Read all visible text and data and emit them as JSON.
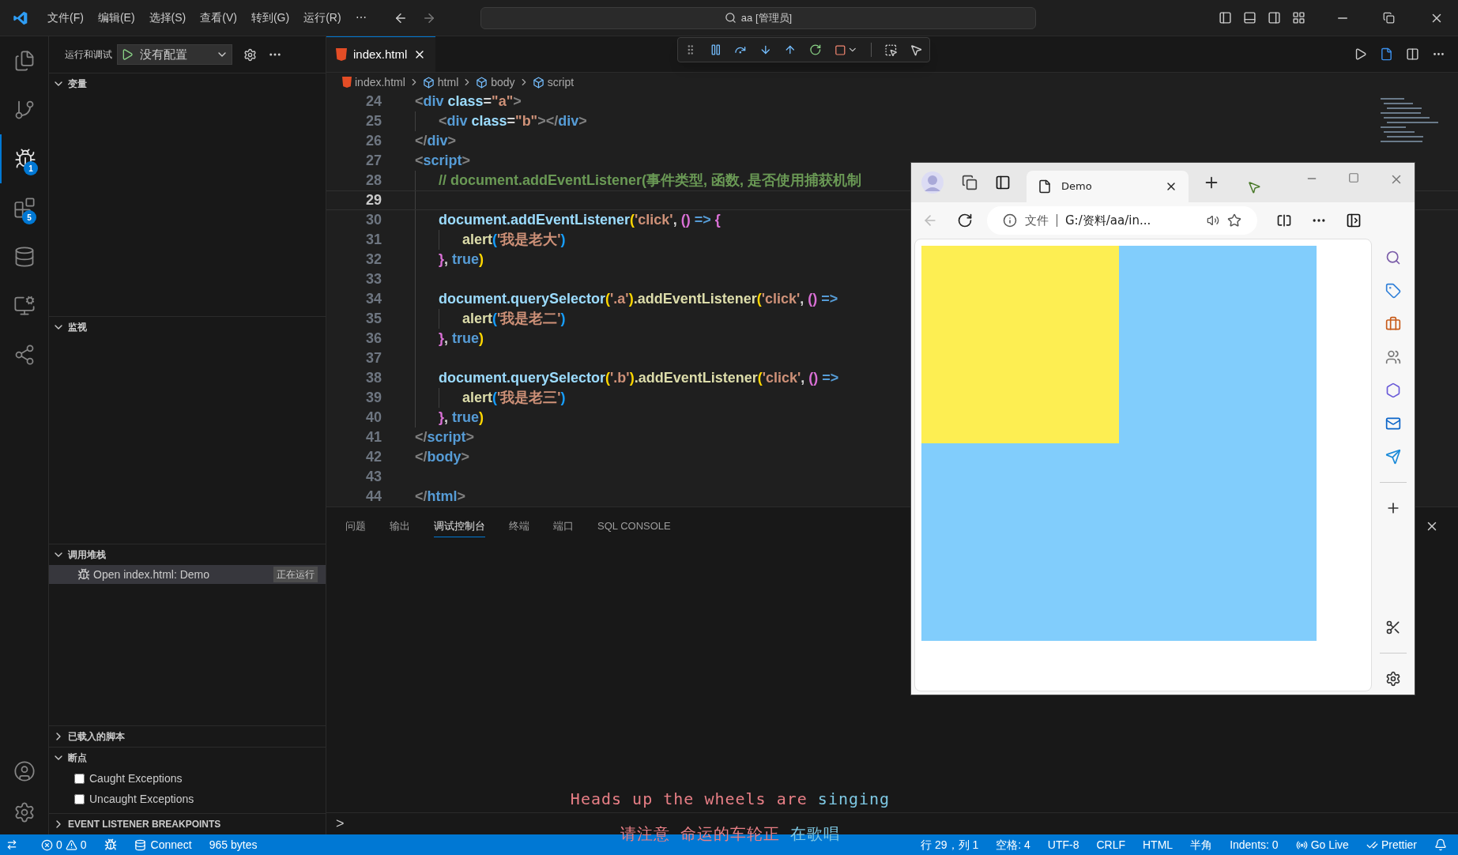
{
  "menu": [
    "文件(F)",
    "编辑(E)",
    "选择(S)",
    "查看(V)",
    "转到(G)",
    "运行(R)",
    "⋯"
  ],
  "command_center": {
    "text": "aa [管理员]"
  },
  "activity_bar": [
    {
      "selected": false
    },
    {
      "selected": false
    },
    {
      "selected": true,
      "badge": "1"
    },
    {
      "selected": false,
      "badge": "5"
    },
    {
      "selected": false
    },
    {
      "selected": false
    },
    {
      "selected": false
    }
  ],
  "sidebar": {
    "title": "运行和调试",
    "config": "没有配置",
    "sections": [
      {
        "kind": "empty",
        "title": "变量",
        "expanded": true
      },
      {
        "kind": "empty",
        "title": "监视",
        "expanded": true
      },
      {
        "kind": "stack",
        "title": "调用堆栈",
        "expanded": true,
        "items": [
          {
            "label": "Open index.html: Demo",
            "status": "正在运行",
            "selected": true
          }
        ]
      },
      {
        "kind": "empty",
        "title": "已载入的脚本",
        "expanded": false
      },
      {
        "kind": "checks",
        "title": "断点",
        "expanded": true,
        "items": [
          {
            "label": "Caught Exceptions",
            "checked": false
          },
          {
            "label": "Uncaught Exceptions",
            "checked": false
          }
        ]
      },
      {
        "kind": "empty",
        "title": "EVENT LISTENER BREAKPOINTS",
        "expanded": false
      }
    ]
  },
  "editor": {
    "tabs": [
      {
        "label": "index.html",
        "selected": true
      }
    ],
    "breadcrumbs": [
      {
        "kind": "file",
        "label": "index.html"
      },
      {
        "kind": "element",
        "label": "html"
      },
      {
        "kind": "element",
        "label": "body"
      },
      {
        "kind": "element",
        "label": "script"
      }
    ],
    "lines": [
      {
        "n": "24",
        "current": false,
        "tokens": [
          {
            "t": "<",
            "kind": "br"
          },
          {
            "t": "div",
            "kind": "tag"
          },
          {
            "t": " class",
            "kind": "attr"
          },
          {
            "t": "=",
            "kind": "punc"
          },
          {
            "t": "\"a\"",
            "kind": "str"
          },
          {
            "t": ">",
            "kind": "br"
          }
        ],
        "children": [
          {
            "n": "25",
            "current": false,
            "tokens": [
              {
                "t": "<",
                "kind": "br"
              },
              {
                "t": "div",
                "kind": "tag"
              },
              {
                "t": " class",
                "kind": "attr"
              },
              {
                "t": "=",
                "kind": "punc"
              },
              {
                "t": "\"b\"",
                "kind": "str"
              },
              {
                "t": "></",
                "kind": "br"
              },
              {
                "t": "div",
                "kind": "tag"
              },
              {
                "t": ">",
                "kind": "br"
              }
            ]
          }
        ]
      },
      {
        "n": "26",
        "current": false,
        "tokens": [
          {
            "t": "</",
            "kind": "br"
          },
          {
            "t": "div",
            "kind": "tag"
          },
          {
            "t": ">",
            "kind": "br"
          }
        ]
      },
      {
        "n": "27",
        "current": false,
        "tokens": [
          {
            "t": "<",
            "kind": "br"
          },
          {
            "t": "script",
            "kind": "tag"
          },
          {
            "t": ">",
            "kind": "br"
          }
        ],
        "children": [
          {
            "n": "28",
            "current": false,
            "tokens": [
              {
                "t": "// document.addEventListener(事件类型, 函数, 是否使用捕获机制",
                "kind": "comment"
              }
            ]
          },
          {
            "n": "29",
            "current": true
          },
          {
            "n": "30",
            "current": false,
            "tokens": [
              {
                "t": "document.addEventListener",
                "kind": "var"
              },
              {
                "t": "(",
                "kind": "p1"
              },
              {
                "t": "'click'",
                "kind": "str"
              },
              {
                "t": ", ",
                "kind": "punc"
              },
              {
                "t": "()",
                "kind": "p2"
              },
              {
                "t": " => ",
                "kind": "kw"
              },
              {
                "t": "{",
                "kind": "p2"
              }
            ],
            "children": [
              {
                "n": "31",
                "current": false,
                "tokens": [
                  {
                    "t": "alert",
                    "kind": "fn"
                  },
                  {
                    "t": "(",
                    "kind": "p3"
                  },
                  {
                    "t": "'我是老大'",
                    "kind": "str"
                  },
                  {
                    "t": ")",
                    "kind": "p3"
                  }
                ]
              }
            ]
          },
          {
            "n": "32",
            "current": false,
            "tokens": [
              {
                "t": "}",
                "kind": "p2"
              },
              {
                "t": ", ",
                "kind": "punc"
              },
              {
                "t": "true",
                "kind": "kw"
              },
              {
                "t": ")",
                "kind": "p1"
              }
            ]
          },
          {
            "n": "33",
            "current": false
          },
          {
            "n": "34",
            "current": false,
            "tokens": [
              {
                "t": "document.querySelector",
                "kind": "var"
              },
              {
                "t": "(",
                "kind": "p1"
              },
              {
                "t": "'.a'",
                "kind": "str"
              },
              {
                "t": ")",
                "kind": "p1"
              },
              {
                "t": ".addEventListener",
                "kind": "fn"
              },
              {
                "t": "(",
                "kind": "p1"
              },
              {
                "t": "'click'",
                "kind": "str"
              },
              {
                "t": ", ",
                "kind": "punc"
              },
              {
                "t": "()",
                "kind": "p2"
              },
              {
                "t": " =>",
                "kind": "kw"
              }
            ],
            "children": [
              {
                "n": "35",
                "current": false,
                "tokens": [
                  {
                    "t": "alert",
                    "kind": "fn"
                  },
                  {
                    "t": "(",
                    "kind": "p3"
                  },
                  {
                    "t": "'我是老二'",
                    "kind": "str"
                  },
                  {
                    "t": ")",
                    "kind": "p3"
                  }
                ]
              }
            ]
          },
          {
            "n": "36",
            "current": false,
            "tokens": [
              {
                "t": "}",
                "kind": "p2"
              },
              {
                "t": ", ",
                "kind": "punc"
              },
              {
                "t": "true",
                "kind": "kw"
              },
              {
                "t": ")",
                "kind": "p1"
              }
            ]
          },
          {
            "n": "37",
            "current": false
          },
          {
            "n": "38",
            "current": false,
            "tokens": [
              {
                "t": "document.querySelector",
                "kind": "var"
              },
              {
                "t": "(",
                "kind": "p1"
              },
              {
                "t": "'.b'",
                "kind": "str"
              },
              {
                "t": ")",
                "kind": "p1"
              },
              {
                "t": ".addEventListener",
                "kind": "fn"
              },
              {
                "t": "(",
                "kind": "p1"
              },
              {
                "t": "'click'",
                "kind": "str"
              },
              {
                "t": ", ",
                "kind": "punc"
              },
              {
                "t": "()",
                "kind": "p2"
              },
              {
                "t": " =>",
                "kind": "kw"
              }
            ],
            "children": [
              {
                "n": "39",
                "current": false,
                "tokens": [
                  {
                    "t": "alert",
                    "kind": "fn"
                  },
                  {
                    "t": "(",
                    "kind": "p3"
                  },
                  {
                    "t": "'我是老三'",
                    "kind": "str"
                  },
                  {
                    "t": ")",
                    "kind": "p3"
                  }
                ]
              }
            ]
          },
          {
            "n": "40",
            "current": false,
            "tokens": [
              {
                "t": "}",
                "kind": "p2"
              },
              {
                "t": ", ",
                "kind": "punc"
              },
              {
                "t": "true",
                "kind": "kw"
              },
              {
                "t": ")",
                "kind": "p1"
              }
            ]
          }
        ]
      },
      {
        "n": "41",
        "current": false,
        "tokens": [
          {
            "t": "</",
            "kind": "br"
          },
          {
            "t": "script",
            "kind": "tag"
          },
          {
            "t": ">",
            "kind": "br"
          }
        ]
      },
      {
        "n": "42",
        "current": false,
        "tokens": [
          {
            "t": "</",
            "kind": "br"
          },
          {
            "t": "body",
            "kind": "tag"
          },
          {
            "t": ">",
            "kind": "br"
          }
        ]
      },
      {
        "n": "43",
        "current": false
      },
      {
        "n": "44",
        "current": false,
        "tokens": [
          {
            "t": "</",
            "kind": "br"
          },
          {
            "t": "html",
            "kind": "tag"
          },
          {
            "t": ">",
            "kind": "br"
          }
        ]
      }
    ]
  },
  "panel": {
    "tabs": [
      {
        "label": "问题",
        "selected": false
      },
      {
        "label": "输出",
        "selected": false
      },
      {
        "label": "调试控制台",
        "selected": true
      },
      {
        "label": "终端",
        "selected": false
      },
      {
        "label": "端口",
        "selected": false
      },
      {
        "label": "SQL CONSOLE",
        "selected": false
      }
    ],
    "prompt": ">"
  },
  "subtitles": [
    {
      "sung": "Heads up the wheels are",
      "unsung": "singing"
    },
    {
      "sung": "请注意 命运的车轮正",
      "unsung": "在歌唱"
    }
  ],
  "browser": {
    "tab": {
      "title": "Demo"
    },
    "address": {
      "scheme": "文件",
      "url": "G:/资料/aa/in..."
    }
  },
  "status_bar": {
    "errors": "0",
    "warnings": "0",
    "connect": "Connect",
    "size": "965 bytes",
    "right": [
      "行 29，列 1",
      "空格: 4",
      "UTF-8",
      "CRLF",
      "HTML",
      "半角",
      "Indents: 0"
    ],
    "go_live": "Go Live",
    "prettier": "Prettier"
  }
}
